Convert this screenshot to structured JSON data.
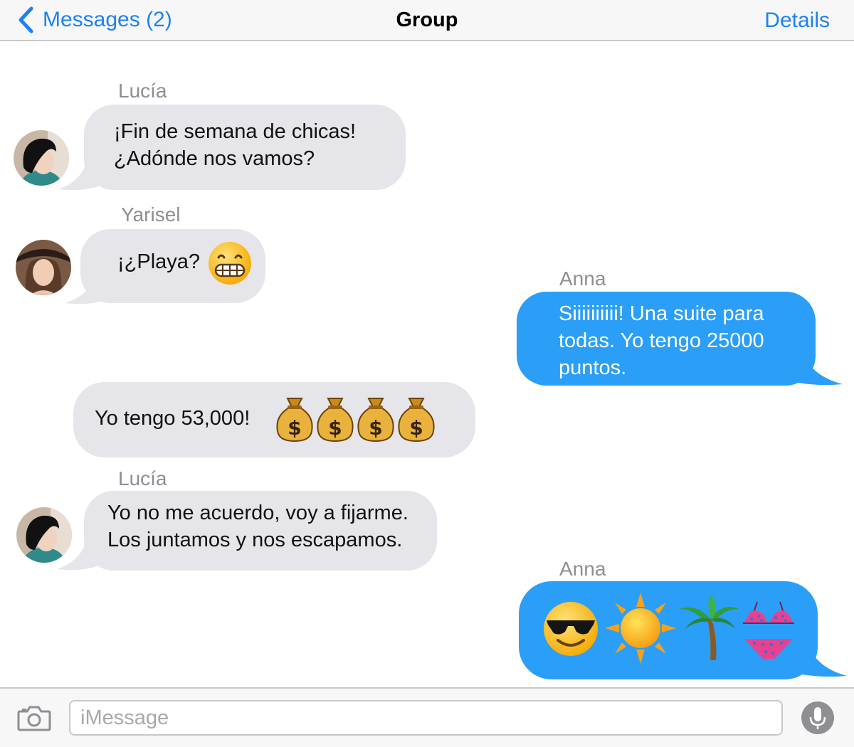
{
  "nav": {
    "back_label": "Messages (2)",
    "title": "Group",
    "details_label": "Details",
    "accent_color": "#1b82f5"
  },
  "messages": [
    {
      "sender": "Lucía",
      "direction": "incoming",
      "lines": [
        "¡Fin de semana de chicas!",
        "¿Adónde nos vamos?"
      ],
      "avatar": "lucia-avatar"
    },
    {
      "sender": "Yarisel",
      "direction": "incoming",
      "text": "¡¿Playa?",
      "emojis": [
        "grimacing-face"
      ],
      "avatar": "yarisel-avatar"
    },
    {
      "sender": "Anna",
      "direction": "outgoing",
      "lines": [
        "Siiiiiiiiii! Una suite para",
        "todas. Yo tengo 25000",
        "puntos."
      ]
    },
    {
      "sender": "",
      "direction": "incoming",
      "text": "Yo tengo 53,000!",
      "emojis": [
        "money-bag",
        "money-bag",
        "money-bag",
        "money-bag"
      ]
    },
    {
      "sender": "Lucía",
      "direction": "incoming",
      "lines": [
        "Yo no me acuerdo, voy a fijarme.",
        "Los juntamos y nos escapamos."
      ],
      "avatar": "lucia-avatar"
    },
    {
      "sender": "Anna",
      "direction": "outgoing",
      "emojis": [
        "smiling-face-with-sunglasses",
        "sun",
        "palm-tree",
        "bikini"
      ]
    }
  ],
  "input": {
    "placeholder": "iMessage",
    "camera_icon": "camera-icon",
    "mic_icon": "microphone-icon"
  },
  "colors": {
    "incoming_bubble": "#e5e5ea",
    "outgoing_bubble": "#2b9ef7",
    "sender_name": "#8e8e93"
  }
}
